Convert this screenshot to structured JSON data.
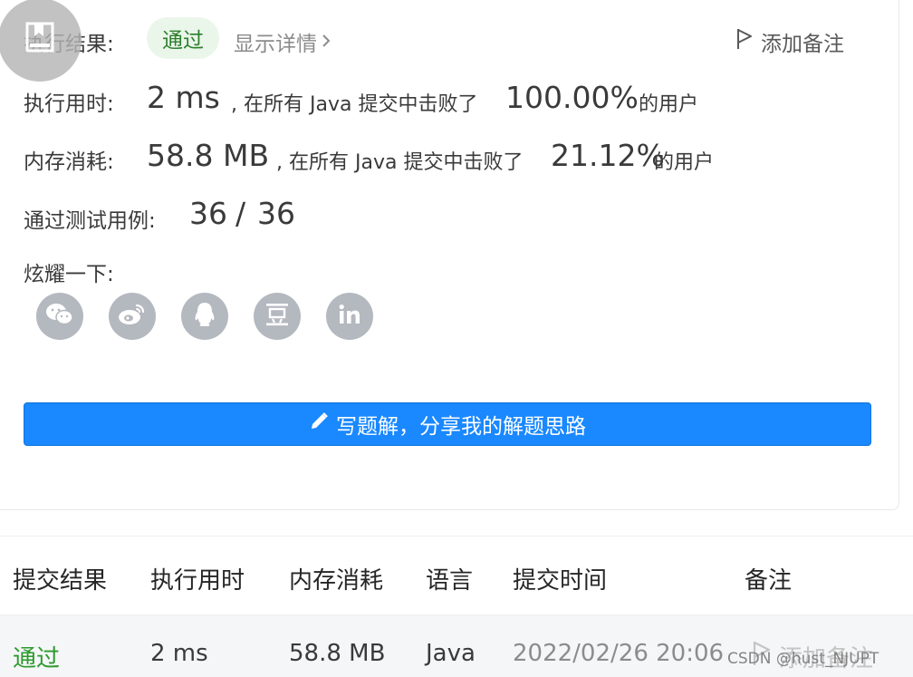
{
  "result": {
    "label": "执行结果:",
    "status": "通过",
    "details_link": "显示详情",
    "add_note": "添加备注"
  },
  "runtime": {
    "label": "执行用时:",
    "value": "2 ms",
    "middle": ", 在所有 Java 提交中击败了",
    "percent": "100.00%",
    "suffix": "的用户"
  },
  "memory": {
    "label": "内存消耗:",
    "value": "58.8 MB",
    "middle": ", 在所有 Java 提交中击败了",
    "percent": "21.12%",
    "suffix": "的用户"
  },
  "tests": {
    "label": "通过测试用例:",
    "passed": "36",
    "separator": "/",
    "total": "36"
  },
  "share": {
    "label": "炫耀一下:",
    "icons": [
      "wechat-icon",
      "weibo-icon",
      "qq-icon",
      "douban-icon",
      "linkedin-icon"
    ]
  },
  "write_solution": {
    "label": "写题解，分享我的解题思路"
  },
  "submissions": {
    "headers": [
      "提交结果",
      "执行用时",
      "内存消耗",
      "语言",
      "提交时间",
      "备注"
    ],
    "rows": [
      {
        "status": "通过",
        "runtime": "2 ms",
        "memory": "58.8 MB",
        "language": "Java",
        "time": "2022/02/26 20:06",
        "note": "添加备注"
      }
    ]
  },
  "watermark": "CSDN @hust_NJUPT",
  "colors": {
    "accent": "#1a88ff",
    "success": "#2c9a2c",
    "icon_gray": "#b4b8bf"
  }
}
